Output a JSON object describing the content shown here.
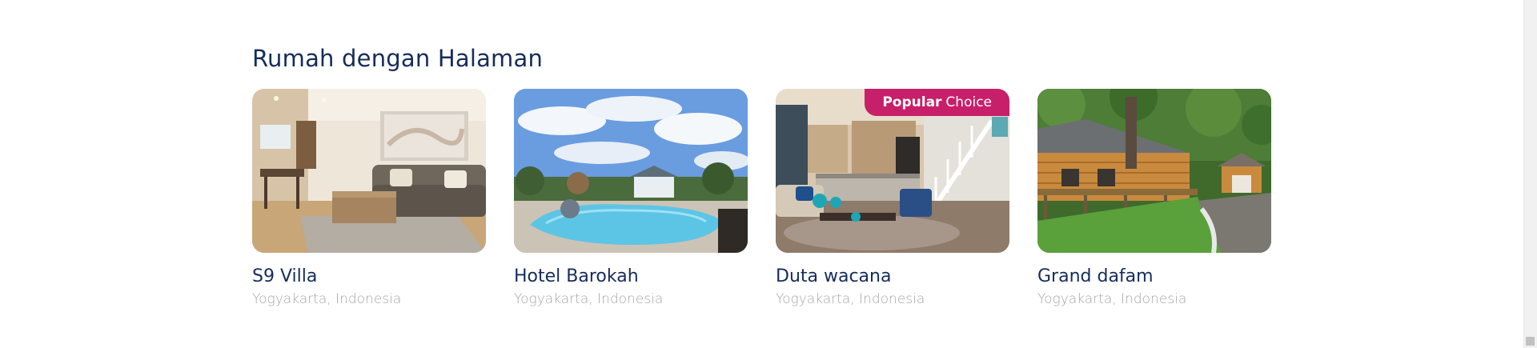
{
  "section": {
    "title": "Rumah dengan Halaman"
  },
  "cards": [
    {
      "name": "S9 Villa",
      "location": "Yogyakarta, Indonesia",
      "image": "living-room-photo"
    },
    {
      "name": "Hotel Barokah",
      "location": "Yogyakarta, Indonesia",
      "image": "pool-photo"
    },
    {
      "name": "Duta wacana",
      "location": "Yogyakarta, Indonesia",
      "image": "interior-stairs-photo",
      "badge": {
        "strong": "Popular",
        "rest": "Choice"
      }
    },
    {
      "name": "Grand dafam",
      "location": "Yogyakarta, Indonesia",
      "image": "log-cabin-photo"
    }
  ],
  "colors": {
    "heading": "#152c5b",
    "muted": "#a6a6a6",
    "badge": "#c81f6a"
  }
}
